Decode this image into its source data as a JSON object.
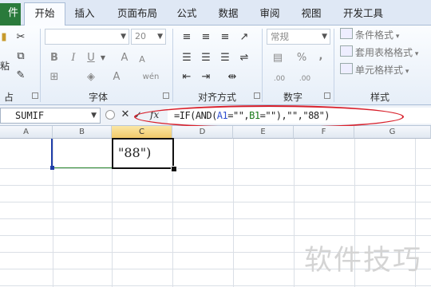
{
  "tabs": {
    "file": "件",
    "items": [
      "开始",
      "插入",
      "页面布局",
      "公式",
      "数据",
      "审阅",
      "视图",
      "开发工具"
    ],
    "active": "开始"
  },
  "ribbon": {
    "clipboard": {
      "paste_label": "粘",
      "group_label": "占板"
    },
    "font": {
      "font_name": "",
      "font_size": "20",
      "bold": "B",
      "italic": "I",
      "underline": "U",
      "grow": "A",
      "shrink": "A",
      "font_color": "A",
      "phonetic": "wén",
      "group_label": "字体"
    },
    "alignment": {
      "group_label": "对齐方式"
    },
    "number": {
      "format": "常规",
      "percent": "%",
      "comma": ",",
      "inc_decimal": ".00",
      "dec_decimal": ".00",
      "group_label": "数字"
    },
    "styles": {
      "conditional": "条件格式",
      "table": "套用表格格式",
      "cell": "单元格样式",
      "group_label": "样式"
    }
  },
  "formula_bar": {
    "name_box": "SUMIF",
    "cancel": "✕",
    "enter": "✓",
    "fx": "fx",
    "parts": [
      "=IF(AND(",
      "A1",
      "=\"\",",
      "B1",
      "=\"\"),\"\",\"88\")"
    ]
  },
  "columns": [
    "A",
    "B",
    "C",
    "D",
    "E",
    "F",
    "G"
  ],
  "selected_column": "C",
  "active_cell_text": "\"88\")",
  "watermark": "软件技巧",
  "colors": {
    "accent_green": "#2a7a3b",
    "ref_a": "#2f4fd0",
    "ref_b": "#1a7a1a",
    "highlight_ring": "#d81f2a"
  }
}
